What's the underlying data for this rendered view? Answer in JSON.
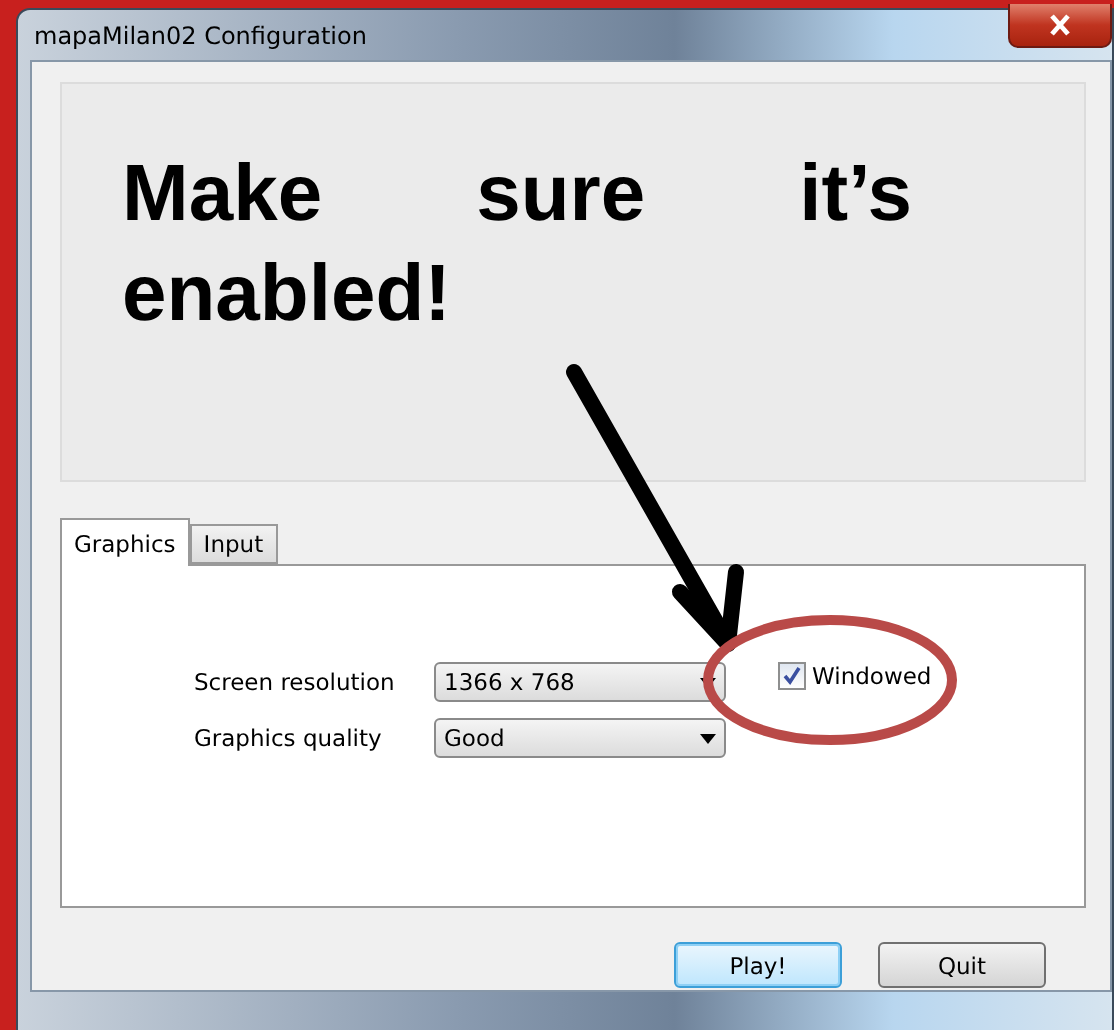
{
  "window": {
    "title": "mapaMilan02 Configuration"
  },
  "banner": {
    "text": "Make sure it’s enabled!"
  },
  "tabs": [
    {
      "label": "Graphics",
      "selected": true
    },
    {
      "label": "Input",
      "selected": false
    }
  ],
  "fields": [
    {
      "label": "Screen resolution",
      "value": "1366 x 768"
    },
    {
      "label": "Graphics quality",
      "value": "Good"
    }
  ],
  "checkbox": {
    "label": "Windowed",
    "checked": true
  },
  "buttons": [
    {
      "label": "Play!",
      "default": true
    },
    {
      "label": "Quit",
      "default": false
    }
  ]
}
